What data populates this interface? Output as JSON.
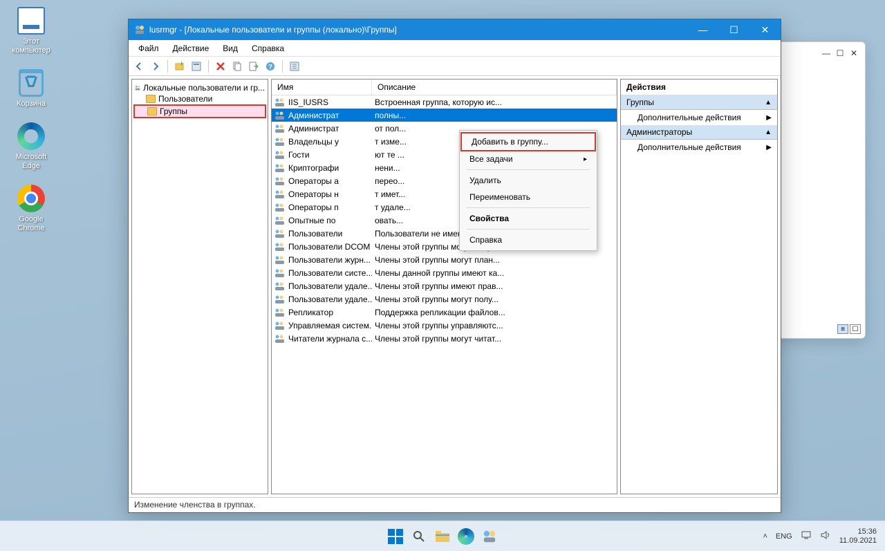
{
  "desktop": {
    "icons": [
      {
        "name": "this-pc",
        "label": "Этот\nкомпьютер"
      },
      {
        "name": "recycle-bin",
        "label": "Корзина"
      },
      {
        "name": "edge",
        "label": "Microsoft\nEdge"
      },
      {
        "name": "chrome",
        "label": "Google\nChrome"
      }
    ]
  },
  "bgwin": {
    "min": "—",
    "max": "☐",
    "close": "✕"
  },
  "window": {
    "title": "lusrmgr - [Локальные пользователи и группы (локально)\\Группы]",
    "menu": [
      "Файл",
      "Действие",
      "Вид",
      "Справка"
    ],
    "status": "Изменение членства в группах."
  },
  "tree": {
    "root": "Локальные пользователи и гр...",
    "users": "Пользователи",
    "groups": "Группы"
  },
  "list": {
    "cols": {
      "name": "Имя",
      "desc": "Описание"
    },
    "rows": [
      {
        "n": "IIS_IUSRS",
        "d": "Встроенная группа, которую ис..."
      },
      {
        "n": "Администрат",
        "d": "полны..."
      },
      {
        "n": "Администрат",
        "d": "от пол..."
      },
      {
        "n": "Владельцы у",
        "d": "т изме..."
      },
      {
        "n": "Гости",
        "d": "ют те ..."
      },
      {
        "n": "Криптографи",
        "d": "нени..."
      },
      {
        "n": "Операторы а",
        "d": "перео..."
      },
      {
        "n": "Операторы н",
        "d": "т имет..."
      },
      {
        "n": "Операторы п",
        "d": "т удале..."
      },
      {
        "n": "Опытные по",
        "d": "овать..."
      },
      {
        "n": "Пользователи",
        "d": "Пользователи не имеют прав н..."
      },
      {
        "n": "Пользователи DCOM",
        "d": "Члены этой группы могут запус..."
      },
      {
        "n": "Пользователи журн...",
        "d": "Члены этой группы могут план..."
      },
      {
        "n": "Пользователи систе...",
        "d": "Члены данной группы имеют ка..."
      },
      {
        "n": "Пользователи удале...",
        "d": "Члены этой группы имеют прав..."
      },
      {
        "n": "Пользователи удале...",
        "d": "Члены этой группы могут полу..."
      },
      {
        "n": "Репликатор",
        "d": "Поддержка репликации файлов..."
      },
      {
        "n": "Управляемая систем...",
        "d": "Члены этой группы управляютс..."
      },
      {
        "n": "Читатели журнала с...",
        "d": "Члены этой группы могут читат..."
      }
    ],
    "selected_index": 1
  },
  "context_menu": {
    "items": [
      {
        "label": "Добавить в группу...",
        "hl": true
      },
      {
        "label": "Все задачи",
        "sub": true
      },
      {
        "sep": true
      },
      {
        "label": "Удалить"
      },
      {
        "label": "Переименовать"
      },
      {
        "sep": true
      },
      {
        "label": "Свойства",
        "bold": true
      },
      {
        "sep": true
      },
      {
        "label": "Справка"
      }
    ]
  },
  "actions": {
    "header": "Действия",
    "sec1": "Группы",
    "more": "Дополнительные действия",
    "sec2": "Администраторы"
  },
  "taskbar": {
    "lang": "ENG",
    "time": "15:36",
    "date": "11.09.2021"
  }
}
